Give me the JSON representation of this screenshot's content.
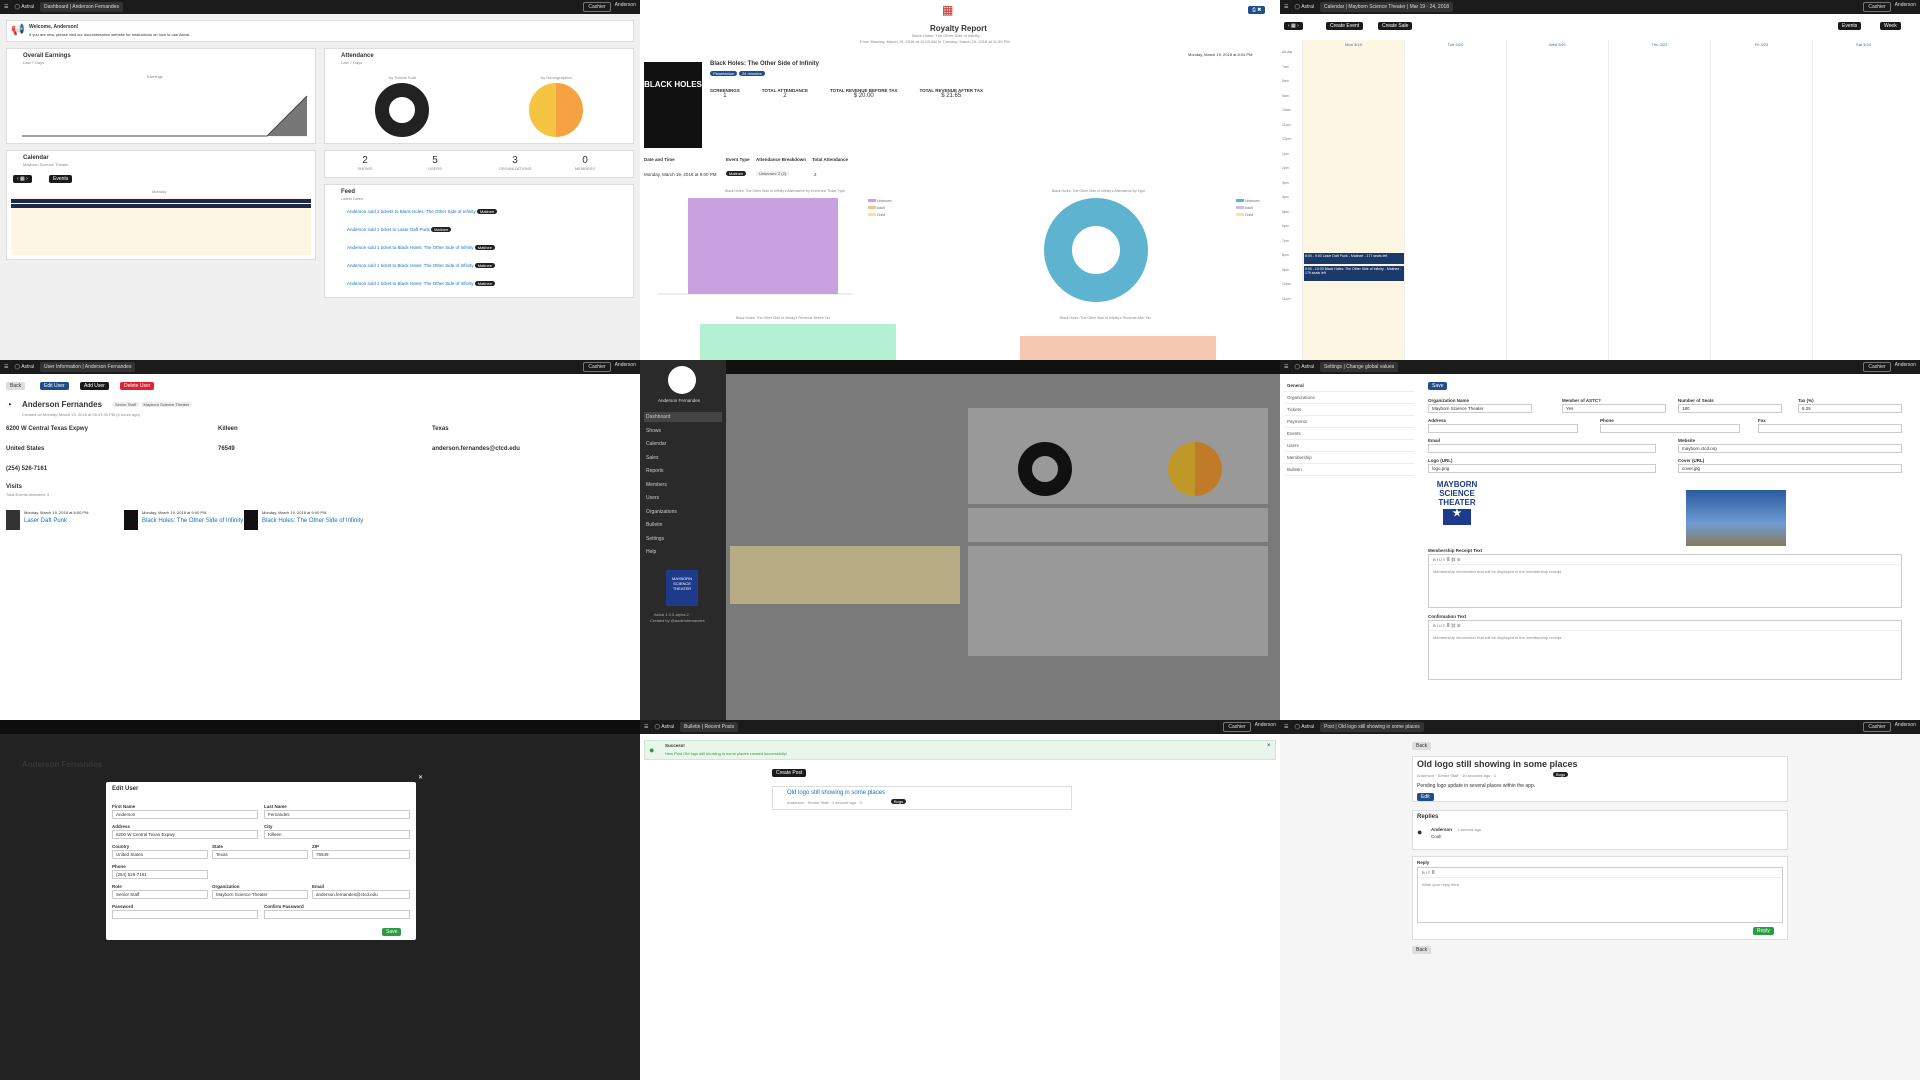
{
  "app": {
    "name": "Astral",
    "cashier": "Cashier",
    "user": "Anderson"
  },
  "dashboard": {
    "crumb": "Dashboard | Anderson Fernandes",
    "welcome_title": "Welcome, Anderson!",
    "welcome_text": "If you are new, please visit our documentation website for instructions on how to use Astral.",
    "earnings_title": "Overall Earnings",
    "earnings_sub": "Last 7 Days",
    "earnings_legend": "Earnings",
    "attendance_title": "Attendance",
    "attendance_sub": "Last 7 Days",
    "pie1_label": "by Tickets Sold",
    "pie2_label": "by Demographics",
    "stats": [
      {
        "value": "2",
        "label": "SHOWS"
      },
      {
        "value": "5",
        "label": "USERS"
      },
      {
        "value": "3",
        "label": "ORGANIZATIONS"
      },
      {
        "value": "0",
        "label": "MEMBERS"
      }
    ],
    "calendar_title": "Calendar",
    "calendar_sub": "Mayborn Science Theater",
    "calendar_day": "Monday",
    "events_btn": "Events",
    "feed_title": "Feed",
    "feed_sub": "Latest Sales",
    "feed": [
      "Anderson sold 2 tickets to Black Holes: The Other Side of Infinity",
      "Anderson sold 1 ticket to Laser Daft Punk",
      "Anderson sold 1 ticket to Black Holes: The Other Side of Infinity",
      "Anderson sold 1 ticket to Black Holes: The Other Side of Infinity",
      "Anderson sold 1 ticket to Black Holes: The Other Side of Infinity"
    ],
    "feed_tag": "Matinee"
  },
  "royalty": {
    "title": "Royalty Report",
    "show": "Black Holes: The Other Side of Infinity",
    "range": "From Monday, March 19, 2018 at 12:00 AM to Tuesday, March 20, 2018 at 11:59 PM",
    "date": "Monday, March 19, 2018 at 8:04 PM",
    "tag1": "Planetarium",
    "tag2": "24 minutes",
    "poster": "BLACK HOLES",
    "metrics": [
      {
        "label": "SCREENINGS",
        "value": "1"
      },
      {
        "label": "TOTAL ATTENDANCE",
        "value": "2"
      },
      {
        "label": "TOTAL REVENUE BEFORE TAX",
        "value": "$ 20.00"
      },
      {
        "label": "TOTAL REVENUE AFTER TAX",
        "value": "$ 21.65"
      }
    ],
    "col_headers": [
      "Date and Time",
      "Event Type",
      "Attendance Breakdown",
      "Total Attendance"
    ],
    "row": [
      "Monday, March 19, 2018 at 9:00 PM",
      "Matinee",
      "Unknown: 2 (2)",
      "2"
    ],
    "chart1_title": "Black Holes: The Other Side of Infinity's Attendance by Event and Ticket Type",
    "chart2_title": "Black Holes: The Other Side of Infinity's Attendance by Type",
    "chart3_title": "Black Holes: The Other Side of Infinity's Revenue Before Tax",
    "chart4_title": "Black Holes: The Other Side of Infinity's Revenue After Tax",
    "legend": [
      "Unknown",
      "Adult",
      "Child"
    ]
  },
  "calendar": {
    "crumb": "Calendar | Mayborn Science Theater | Mar 19 - 24, 2018",
    "create_event": "Create Event",
    "create_sale": "Create Sale",
    "events": "Events",
    "week": "Week",
    "days": [
      "Mon 3/19",
      "Tue 3/20",
      "Wed 3/21",
      "Thu 3/22",
      "Fri 3/23",
      "Sat 3/24"
    ],
    "times": [
      "all-day",
      "7am",
      "8am",
      "9am",
      "10am",
      "11am",
      "12pm",
      "1pm",
      "2pm",
      "3pm",
      "4pm",
      "5pm",
      "6pm",
      "7pm",
      "8pm",
      "9pm",
      "10pm",
      "11pm"
    ],
    "ev1": "8:00 - 9:00 Laser Daft Punk - Matinee - 177 seats left",
    "ev2": "9:00 - 10:00 Black Holes: The Other Side of Infinity - Matinee - 179 seats left"
  },
  "user": {
    "crumb": "User Information | Anderson Fernandes",
    "back": "Back",
    "edit": "Edit User",
    "add": "Add User",
    "delete": "Delete User",
    "name": "Anderson Fernandes",
    "role": "Senior Staff",
    "org": "Mayborn Science Theater",
    "created": "Created on Monday, March 19, 2018 at 05:47:30 PM (4 hours ago)",
    "address": "6200 W Central Texas Expwy",
    "city": "Killeen",
    "state": "Texas",
    "country": "United States",
    "zip": "76549",
    "email": "anderson.fernandes@ctcd.edu",
    "phone": "(254) 526-7161",
    "visits_title": "Visits",
    "visits_sub": "Total Events Attended: 3",
    "visits": [
      {
        "date": "Monday, March 19, 2018 at 8:00 PM",
        "show": "Laser Daft Punk"
      },
      {
        "date": "Monday, March 19, 2018 at 9:00 PM",
        "show": "Black Holes: The Other Side of Infinity"
      },
      {
        "date": "Monday, March 19, 2018 at 9:00 PM",
        "show": "Black Holes: The Other Side of Infinity"
      }
    ]
  },
  "sidebar": {
    "name": "Anderson Fernandes",
    "items": [
      "Dashboard",
      "Shows",
      "Calendar",
      "Sales",
      "Reports",
      "Members",
      "Users",
      "Organizations",
      "Bulletin",
      "Settings",
      "Help"
    ],
    "logo": "MAYBORN SCIENCE THEATER",
    "footer1": "Astral 1.0.0-alpha.2",
    "footer2": "Created by @andersfernandes"
  },
  "settings": {
    "crumb": "Settings | Change global values",
    "nav": [
      "General",
      "Organizations",
      "Tickets",
      "Payments",
      "Events",
      "Users",
      "Membership",
      "Bulletin"
    ],
    "save": "Save",
    "org_name_label": "Organization Name",
    "org_name": "Mayborn Science Theater",
    "astc_label": "Member of ASTC?",
    "astc": "Yes",
    "seats_label": "Number of Seats",
    "seats": "180",
    "tax_label": "Tax (%)",
    "tax": "8.25",
    "address_label": "Address",
    "phone_label": "Phone",
    "fax_label": "Fax",
    "email_label": "Email",
    "website_label": "Website",
    "website": "mayborn.ctcd.org",
    "logo_label": "Logo (URL)",
    "logo": "logo.png",
    "cover_label": "Cover (URL)",
    "cover": "cover.jpg",
    "logo_text": "MAYBORN SCIENCE THEATER",
    "receipt_label": "Membership Receipt Text",
    "confirm_label": "Confirmation Text",
    "editor_ph": "Membership information that will be displayed in the membership receipt."
  },
  "modal": {
    "title": "Edit User",
    "first_label": "First Name",
    "first": "Anderson",
    "last_label": "Last Name",
    "last": "Fernandes",
    "address_label": "Address",
    "address": "6200 W Central Texas Expwy",
    "city_label": "City",
    "city": "Killeen",
    "country_label": "Country",
    "country": "United States",
    "state_label": "State",
    "state": "Texas",
    "zip_label": "ZIP",
    "zip": "76549",
    "phone_label": "Phone",
    "phone": "(254) 526-7161",
    "role_label": "Role",
    "role": "Senior Staff",
    "org_label": "Organization",
    "org": "Mayborn Science Theater",
    "email_label": "Email",
    "email": "anderson.fernandes@ctcd.edu",
    "password_label": "Password",
    "confirm_label": "Confirm Password",
    "save": "Save"
  },
  "bulletin": {
    "crumb": "Bulletin | Recent Posts",
    "success_title": "Success!",
    "success_text": "New Post Old logo still showing in some places created successfully!",
    "create_post": "Create Post",
    "post_title": "Old logo still showing in some places",
    "post_meta": "Anderson · Senior Staff · 1 second ago · 0",
    "post_tag": "Bugs"
  },
  "post": {
    "crumb": "Post | Old logo still showing in some places",
    "back": "Back",
    "title": "Old logo still showing in some places",
    "meta": "Anderson · Senior Staff · 19 seconds ago · 1",
    "tag": "Bugs",
    "body": "Pending logo update in several places within the app.",
    "edit": "Edit",
    "replies": "Replies",
    "reply_author": "Anderson",
    "reply_time": "1 second ago",
    "reply_text": "Cool!",
    "reply_label": "Reply",
    "reply_ph": "Write your reply here",
    "reply_btn": "Reply"
  }
}
